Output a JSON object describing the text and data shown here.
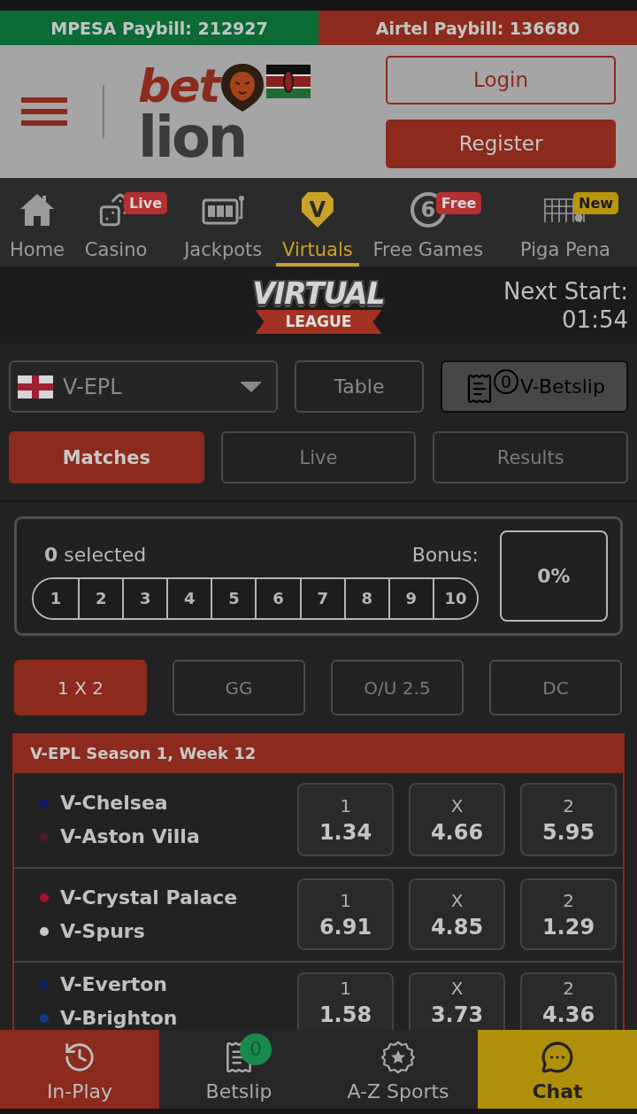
{
  "paybill": [
    {
      "label": "MPESA Paybill: 212927",
      "color": "#0b6a35"
    },
    {
      "label": "Airtel Paybill: 136680",
      "color": "#8b2a1d"
    }
  ],
  "header": {
    "logo": {
      "word_1": "bet",
      "word_2": "lion"
    },
    "buttons": [
      {
        "label": "Login",
        "kind": "outline"
      },
      {
        "label": "Register",
        "kind": "filled"
      }
    ]
  },
  "nav": [
    {
      "label": "Home",
      "selected": false
    },
    {
      "label": "Casino",
      "selected": false,
      "badge": {
        "text": "Live",
        "kind": "primary"
      }
    },
    {
      "label": "Jackpots",
      "selected": false
    },
    {
      "label": "Virtuals",
      "glyph": "V",
      "selected": true
    },
    {
      "label": "Free Games",
      "glyph": "6",
      "selected": false,
      "badge": {
        "text": "Free",
        "kind": "primary"
      }
    },
    {
      "label": "Piga Pena",
      "selected": false,
      "badge": {
        "text": "New",
        "kind": "secondary"
      }
    }
  ],
  "banner": {
    "logo": {
      "title": "VIRTUAL",
      "ribbon": "LEAGUE"
    },
    "next_start": {
      "label": "Next Start:",
      "time": "01:54"
    }
  },
  "league_select": {
    "value": "V-EPL"
  },
  "actions": [
    {
      "label": "Table",
      "kind": "plain"
    },
    {
      "label": "V-Betslip",
      "kind": "betslip",
      "count": "0"
    }
  ],
  "view_tabs": [
    {
      "label": "Matches",
      "selected": true
    },
    {
      "label": "Live",
      "selected": false
    },
    {
      "label": "Results",
      "selected": false
    }
  ],
  "multibet": {
    "selected_text": "**0** selected",
    "bonus_label": "Bonus:",
    "bonus_value": "0%",
    "picks": [
      {
        "label": "1",
        "selected": false
      },
      {
        "label": "2",
        "selected": false
      },
      {
        "label": "3",
        "selected": false
      },
      {
        "label": "4",
        "selected": false
      },
      {
        "label": "5",
        "selected": false
      },
      {
        "label": "6",
        "selected": false
      },
      {
        "label": "7",
        "selected": false
      },
      {
        "label": "8",
        "selected": false
      },
      {
        "label": "9",
        "selected": false
      },
      {
        "label": "10",
        "selected": false
      }
    ]
  },
  "market_tabs": [
    {
      "label": "1 X 2",
      "selected": true
    },
    {
      "label": "GG",
      "selected": false
    },
    {
      "label": "O/U 2.5",
      "selected": false
    },
    {
      "label": "DC",
      "selected": false
    }
  ],
  "match_group": {
    "title": "V-EPL Season 1, Week 12",
    "matches": [
      {
        "home": {
          "name": "V-Chelsea",
          "color": "#0a1b6b"
        },
        "away": {
          "name": "V-Aston Villa",
          "color": "#4f1a26"
        },
        "odds": [
          {
            "label": "1",
            "value": "1.34"
          },
          {
            "label": "X",
            "value": "4.66"
          },
          {
            "label": "2",
            "value": "5.95"
          }
        ]
      },
      {
        "home": {
          "name": "V-Crystal Palace",
          "color": "#a8132b"
        },
        "away": {
          "name": "V-Spurs",
          "color": "#c8c8c8"
        },
        "odds": [
          {
            "label": "1",
            "value": "6.91"
          },
          {
            "label": "X",
            "value": "4.85"
          },
          {
            "label": "2",
            "value": "1.29"
          }
        ]
      },
      {
        "home": {
          "name": "V-Everton",
          "color": "#0b1f6e"
        },
        "away": {
          "name": "V-Brighton",
          "color": "#0c3b8c"
        },
        "odds": [
          {
            "label": "1",
            "value": "1.58"
          },
          {
            "label": "X",
            "value": "3.73"
          },
          {
            "label": "2",
            "value": "4.36"
          }
        ]
      }
    ]
  },
  "bottom_nav": [
    {
      "label": "In-Play",
      "kind": "accent"
    },
    {
      "label": "Betslip",
      "kind": "plain",
      "badge": "0"
    },
    {
      "label": "A-Z Sports",
      "kind": "plain"
    },
    {
      "label": "Chat",
      "kind": "highlight"
    }
  ]
}
